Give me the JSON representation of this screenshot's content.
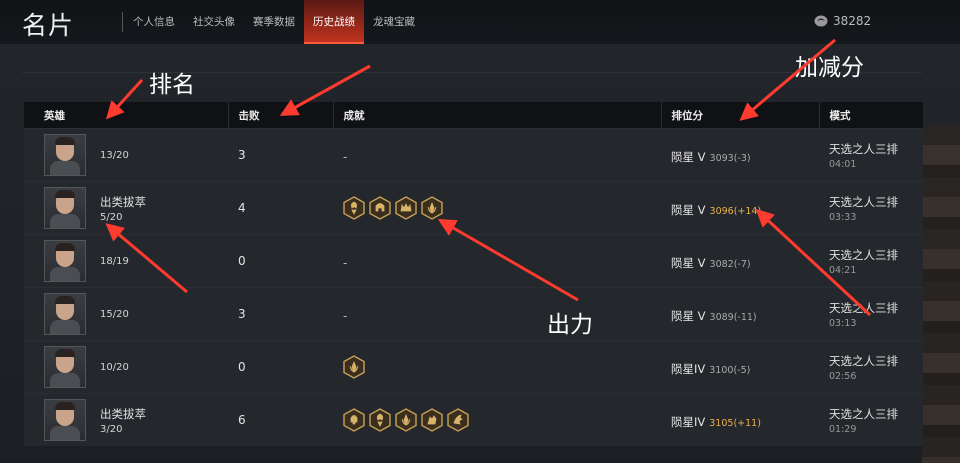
{
  "header": {
    "title": "名片",
    "tabs": [
      {
        "label": "个人信息",
        "active": false
      },
      {
        "label": "社交头像",
        "active": false
      },
      {
        "label": "赛季数据",
        "active": false
      },
      {
        "label": "历史战绩",
        "active": true
      },
      {
        "label": "龙魂宝藏",
        "active": false
      }
    ],
    "currency": "38282"
  },
  "table": {
    "columns": [
      "英雄",
      "击败",
      "成就",
      "排位分",
      "模式"
    ],
    "rows": [
      {
        "title": "",
        "rank": "13/20",
        "kills": "3",
        "achievements": [],
        "achievement_text": "-",
        "tier": "陨星 V",
        "score": "3093(-3)",
        "score_gold": false,
        "mode": "天选之人三排",
        "duration": "04:01"
      },
      {
        "title": "出类拔萃",
        "rank": "5/20",
        "kills": "4",
        "achievements": [
          "crest-icon",
          "helmet-icon",
          "crown-icon",
          "wreath-icon"
        ],
        "achievement_text": "",
        "tier": "陨星 V",
        "score": "3096(+14)",
        "score_gold": true,
        "mode": "天选之人三排",
        "duration": "03:33"
      },
      {
        "title": "",
        "rank": "18/19",
        "kills": "0",
        "achievements": [],
        "achievement_text": "-",
        "tier": "陨星 V",
        "score": "3082(-7)",
        "score_gold": false,
        "mode": "天选之人三排",
        "duration": "04:21"
      },
      {
        "title": "",
        "rank": "15/20",
        "kills": "3",
        "achievements": [],
        "achievement_text": "-",
        "tier": "陨星 V",
        "score": "3089(-11)",
        "score_gold": false,
        "mode": "天选之人三排",
        "duration": "03:13"
      },
      {
        "title": "",
        "rank": "10/20",
        "kills": "0",
        "achievements": [
          "wreath-icon"
        ],
        "achievement_text": "",
        "tier": "陨星IV",
        "score": "3100(-5)",
        "score_gold": false,
        "mode": "天选之人三排",
        "duration": "02:56"
      },
      {
        "title": "出类拔萃",
        "rank": "3/20",
        "kills": "6",
        "achievements": [
          "skull-icon",
          "crest-icon",
          "wreath-icon",
          "beast-icon",
          "dragon-icon"
        ],
        "achievement_text": "",
        "tier": "陨星IV",
        "score": "3105(+11)",
        "score_gold": true,
        "mode": "天选之人三排",
        "duration": "01:29"
      }
    ]
  },
  "annotations": {
    "ranking": "排名",
    "output": "出力",
    "score_change": "加减分"
  },
  "colors": {
    "accent": "#c0321f",
    "gold": "#e8b04a",
    "arrow": "#ff3b30"
  }
}
